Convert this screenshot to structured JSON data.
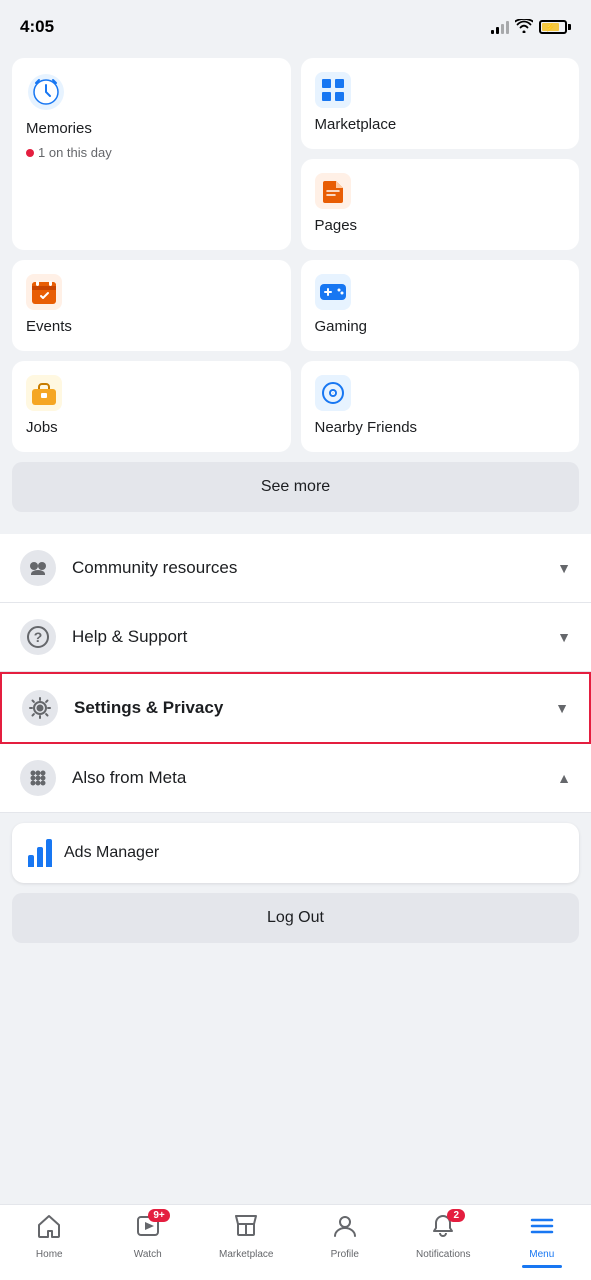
{
  "statusBar": {
    "time": "4:05",
    "batteryCharging": true
  },
  "gridItems": {
    "memories": {
      "label": "Memories",
      "sublabel": "1 on this day"
    },
    "marketplace": {
      "label": "Marketplace"
    },
    "pages": {
      "label": "Pages"
    },
    "events": {
      "label": "Events"
    },
    "gaming": {
      "label": "Gaming"
    },
    "jobs": {
      "label": "Jobs"
    },
    "nearbyFriends": {
      "label": "Nearby Friends"
    }
  },
  "buttons": {
    "seeMore": "See more",
    "logOut": "Log Out"
  },
  "menuItems": [
    {
      "id": "community",
      "label": "Community resources",
      "iconType": "handshake",
      "chevron": "▼"
    },
    {
      "id": "help",
      "label": "Help & Support",
      "iconType": "question",
      "chevron": "▼"
    },
    {
      "id": "settings",
      "label": "Settings & Privacy",
      "iconType": "gear",
      "chevron": "▼",
      "highlighted": true
    },
    {
      "id": "meta",
      "label": "Also from Meta",
      "iconType": "grid",
      "chevron": "▲"
    }
  ],
  "adsManager": {
    "label": "Ads Manager"
  },
  "bottomNav": {
    "items": [
      {
        "id": "home",
        "label": "Home",
        "iconType": "home",
        "active": false,
        "badge": null
      },
      {
        "id": "watch",
        "label": "Watch",
        "iconType": "watch",
        "active": false,
        "badge": "9+"
      },
      {
        "id": "marketplace",
        "label": "Marketplace",
        "iconType": "marketplace",
        "active": false,
        "badge": null
      },
      {
        "id": "profile",
        "label": "Profile",
        "iconType": "profile",
        "active": false,
        "badge": null
      },
      {
        "id": "notifications",
        "label": "Notifications",
        "iconType": "bell",
        "active": false,
        "badge": "2"
      },
      {
        "id": "menu",
        "label": "Menu",
        "iconType": "menu",
        "active": true,
        "badge": null
      }
    ]
  }
}
